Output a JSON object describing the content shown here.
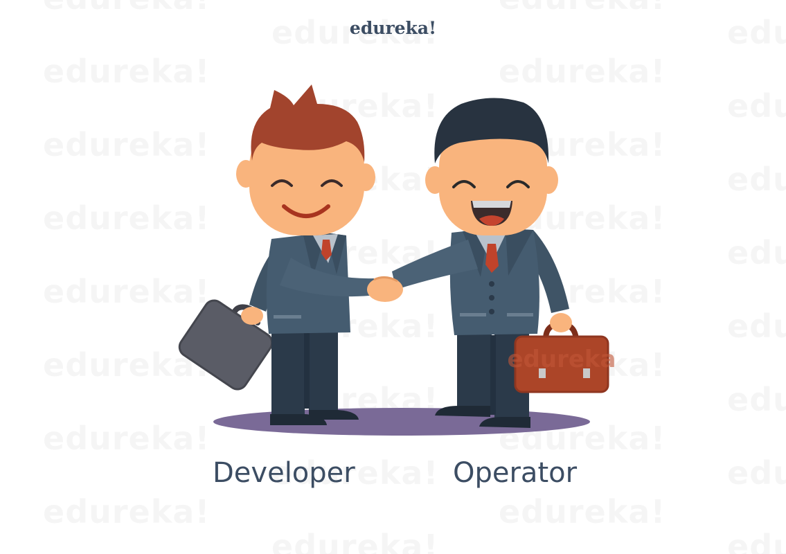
{
  "brand": {
    "logo_text": "edureka!"
  },
  "watermark": {
    "text": "edureka!"
  },
  "labels": {
    "developer": "Developer",
    "operator": "Operator"
  },
  "colors": {
    "brand_text": "#3c4d63",
    "suit": "#455c70",
    "suit_dark": "#2f4050",
    "trousers": "#2b3a4a",
    "skin": "#f9b47d",
    "developer_hair": "#a2442d",
    "operator_hair": "#283340",
    "tie": "#c0432b",
    "developer_briefcase": "#5a5c66",
    "operator_briefcase": "#ac4528",
    "ground_shadow": "#7a6a97"
  },
  "briefcase_text": "edureka"
}
